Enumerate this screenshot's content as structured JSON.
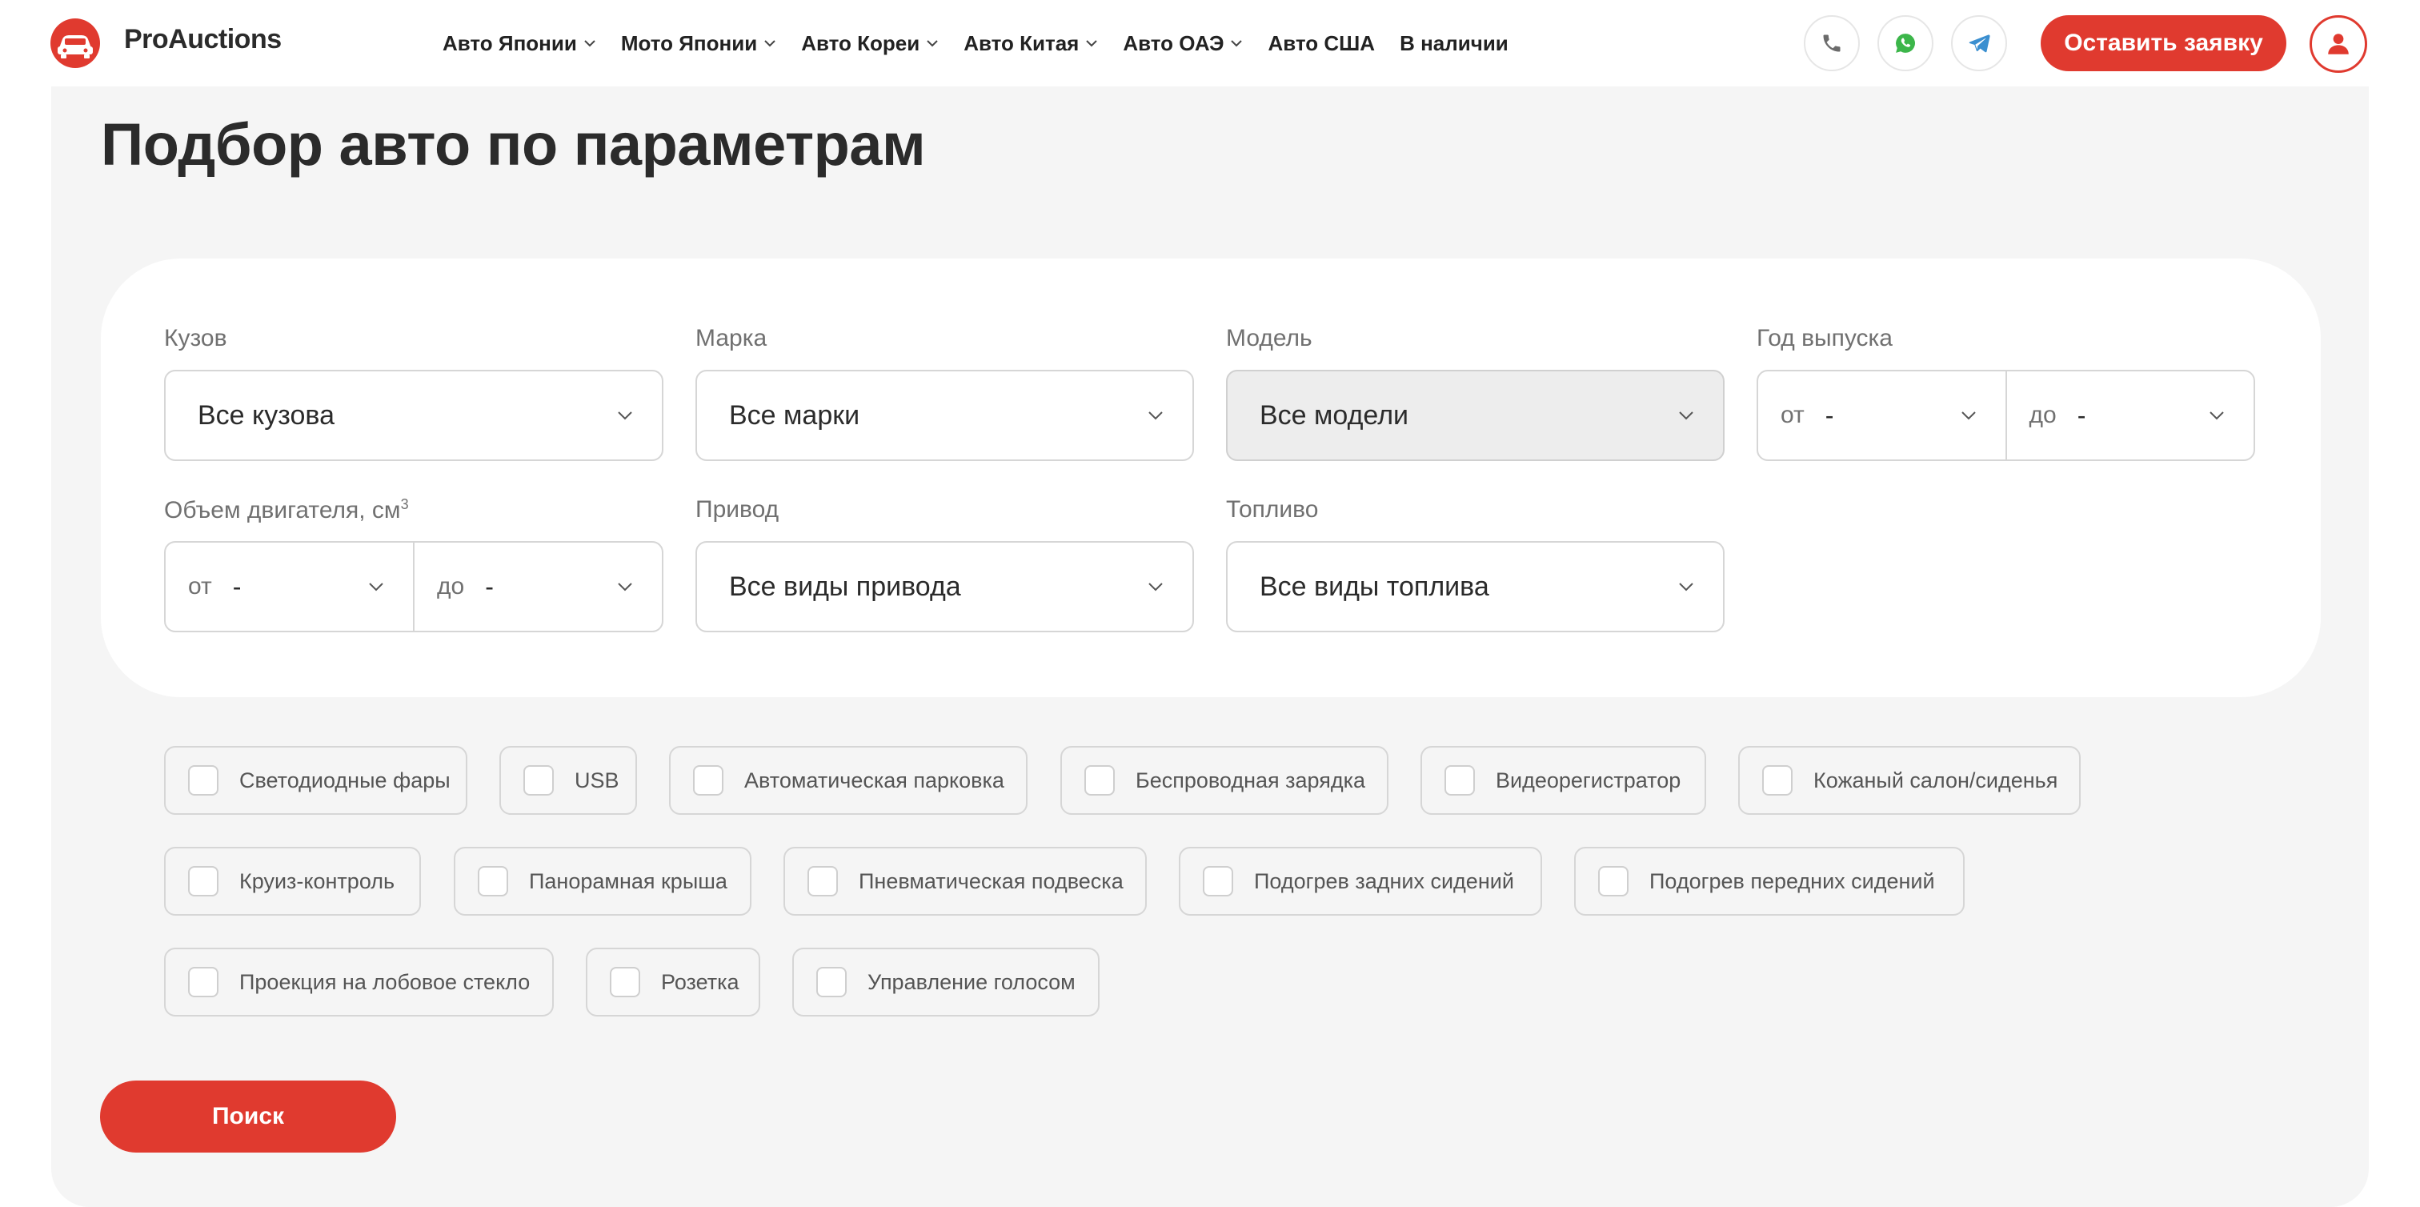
{
  "brand": {
    "name": "ProAuctions",
    "accent": "#e03a2f"
  },
  "nav": [
    {
      "label": "Авто Японии"
    },
    {
      "label": "Мото Японии"
    },
    {
      "label": "Авто Кореи"
    },
    {
      "label": "Авто Китая"
    },
    {
      "label": "Авто ОАЭ"
    },
    {
      "label": "Авто США"
    },
    {
      "label": "В наличии"
    }
  ],
  "header": {
    "cta_label": "Оставить заявку",
    "icons": [
      "phone-icon",
      "whatsapp-icon",
      "telegram-icon",
      "user-icon"
    ]
  },
  "page": {
    "title": "Подбор авто по параметрам"
  },
  "filters": {
    "body": {
      "label": "Кузов",
      "value": "Все кузова"
    },
    "make": {
      "label": "Марка",
      "value": "Все марки"
    },
    "model": {
      "label": "Модель",
      "value": "Все модели",
      "disabled": true
    },
    "year": {
      "label": "Год выпуска",
      "from_prefix": "от",
      "from_value": "-",
      "to_prefix": "до",
      "to_value": "-"
    },
    "engine": {
      "label": "Объем двигателя, см",
      "label_sup": "3",
      "from_prefix": "от",
      "from_value": "-",
      "to_prefix": "до",
      "to_value": "-"
    },
    "drive": {
      "label": "Привод",
      "value": "Все виды привода"
    },
    "fuel": {
      "label": "Топливо",
      "value": "Все виды топлива"
    }
  },
  "options": [
    "Светодиодные фары",
    "USB",
    "Автоматическая парковка",
    "Беспроводная зарядка",
    "Видеорегистратор",
    "Кожаный салон/сиденья",
    "Круиз-контроль",
    "Панорамная крыша",
    "Пневматическая подвеска",
    "Подогрев задних сидений",
    "Подогрев передних сидений",
    "Проекция на лобовое стекло",
    "Розетка",
    "Управление голосом"
  ],
  "search_label": "Поиск"
}
